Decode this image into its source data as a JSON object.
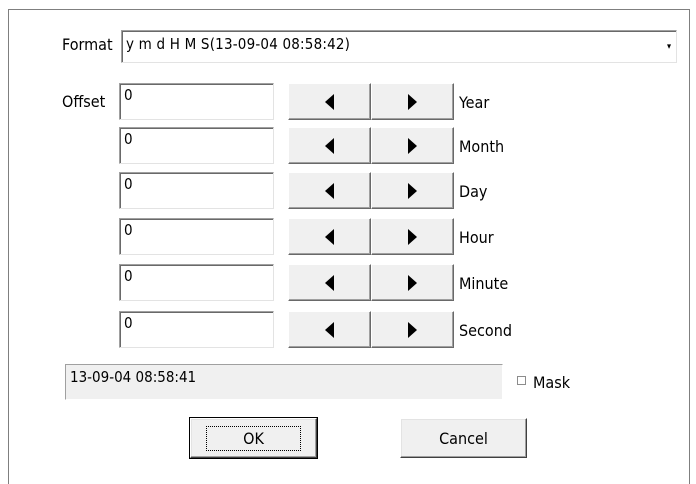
{
  "format": {
    "label": "Format",
    "value": "y m d H M S(13-09-04 08:58:42)"
  },
  "offset": {
    "label": "Offset",
    "rows": [
      {
        "value": "0",
        "unit": "Year"
      },
      {
        "value": "0",
        "unit": "Month"
      },
      {
        "value": "0",
        "unit": "Day"
      },
      {
        "value": "0",
        "unit": "Hour"
      },
      {
        "value": "0",
        "unit": "Minute"
      },
      {
        "value": "0",
        "unit": "Second"
      }
    ]
  },
  "result": {
    "value": "13-09-04 08:58:41"
  },
  "mask": {
    "label": "Mask",
    "checked": false
  },
  "buttons": {
    "ok": "OK",
    "cancel": "Cancel"
  },
  "icons": {
    "decrement": "left-arrow-icon",
    "increment": "right-arrow-icon",
    "dropdown": "dropdown-arrow-icon"
  }
}
